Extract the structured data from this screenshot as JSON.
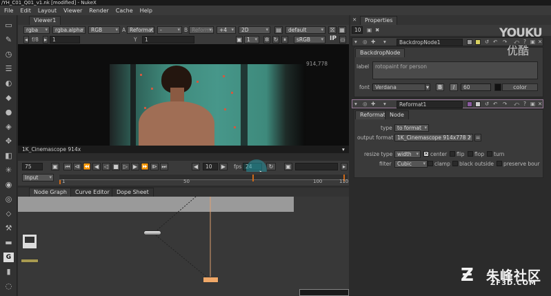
{
  "window": {
    "title": "/YH_C01_Q01_v1.nk [modified] - NukeX"
  },
  "menu": [
    "File",
    "Edit",
    "Layout",
    "Viewer",
    "Render",
    "Cache",
    "Help"
  ],
  "viewer": {
    "tab": "Viewer1",
    "row1": {
      "channels": "rgba",
      "layer": "rgba.alpha",
      "display": "RGB",
      "a_label": "A",
      "a_input": "Reformat1",
      "a_op": "-",
      "b_label": "B",
      "b_input": "Reformat1",
      "wipe": "+4",
      "view": "2D",
      "lut": "default"
    },
    "row2": {
      "fstop": "f/8",
      "gain": "1",
      "y_label": "Y",
      "gamma": "1",
      "proxy": "1",
      "colorspace": "sRGB",
      "ip": "IP"
    },
    "image_dim": "914,778",
    "format_label": "1K_Cinemascope 914x",
    "timeline": {
      "frame": "75",
      "step": "10",
      "fps_label": "fps",
      "fps": "24",
      "input_mode": "Input",
      "ticks": [
        "1",
        "50",
        "100",
        "110"
      ]
    }
  },
  "nodegraph": {
    "tabs": [
      "Node Graph",
      "Curve Editor",
      "Dope Sheet"
    ]
  },
  "properties": {
    "title": "Properties",
    "max_panels": "10",
    "backdrop": {
      "name": "BackdropNode1",
      "tab": "BackdropNode",
      "label_caption": "label",
      "label_value": "rotopaint for person",
      "font_caption": "font",
      "font_value": "Verdana",
      "bold": "B",
      "italic": "I",
      "font_size": "60",
      "color_label": "color"
    },
    "reformat": {
      "name": "Reformat1",
      "tabs": [
        "Reformat",
        "Node"
      ],
      "type_caption": "type",
      "type_value": "to format",
      "output_caption": "output format",
      "output_value": "1K_Cinemascope 914x778 2",
      "resize_caption": "resize type",
      "resize_value": "width",
      "center": "center",
      "flip": "flip",
      "flop": "flop",
      "turn": "turn",
      "filter_caption": "filter",
      "filter_value": "Cubic",
      "clamp": "clamp",
      "black_outside": "black outside",
      "preserve": "preserve bour"
    }
  },
  "watermarks": {
    "youku": "YOUKU",
    "youku_cn": "优酷",
    "zf_cn": "朱峰社区",
    "zf_en": "ZF3D.COM"
  },
  "colors": {
    "accent": "#d06a18",
    "selected_node": "#f0a868",
    "screen_green": "#3f8a7c",
    "panel_bg": "#3a3a3a"
  }
}
